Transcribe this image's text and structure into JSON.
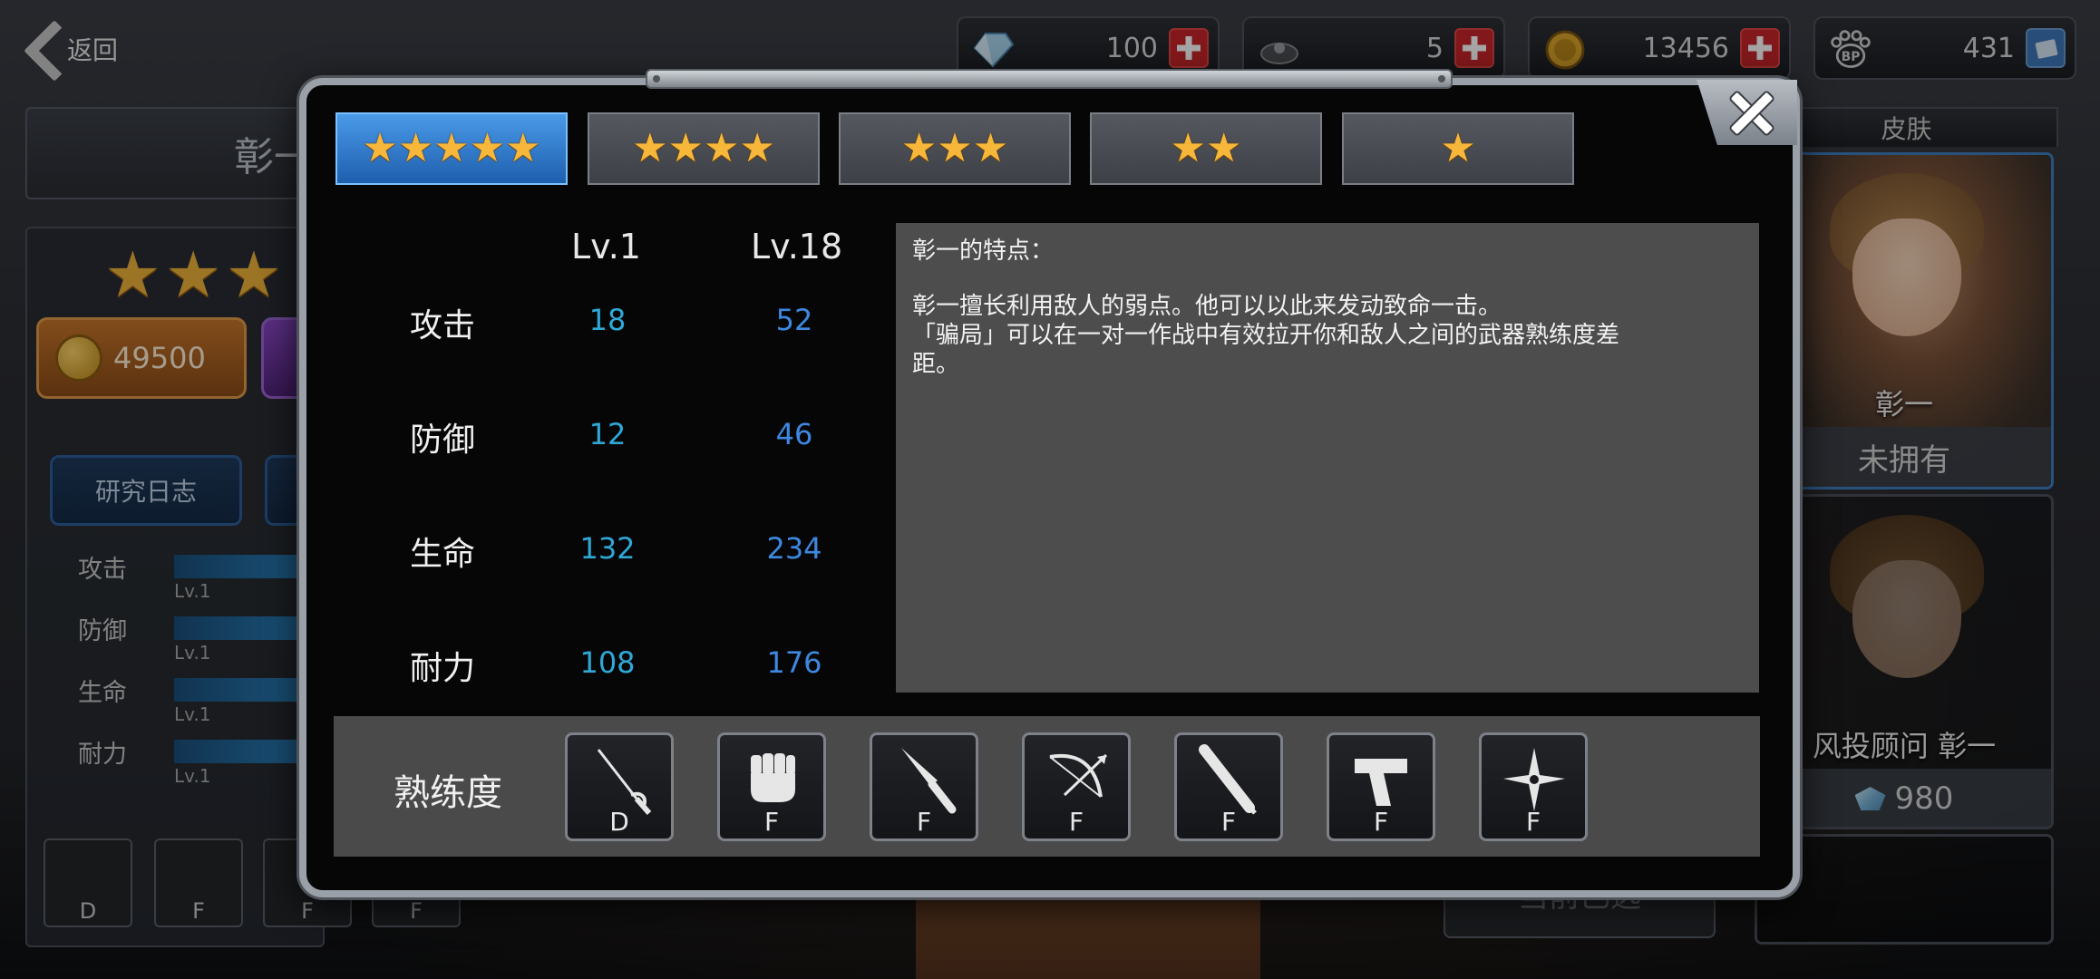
{
  "top_bar": {
    "back_label": "返回",
    "currencies": [
      {
        "icon": "diamond-icon",
        "value": "100"
      },
      {
        "icon": "ticket-icon",
        "value": "5"
      },
      {
        "icon": "gold-coin-icon",
        "value": "13456"
      },
      {
        "icon": "bp-paw-icon",
        "value": "431"
      }
    ]
  },
  "background_left": {
    "character_name_partial": "彰一",
    "gold_cost": "49500",
    "research_tab": "研究日志",
    "stats": [
      {
        "label": "攻击",
        "lv": "Lv.1"
      },
      {
        "label": "防御",
        "lv": "Lv.1"
      },
      {
        "label": "生命",
        "lv": "Lv.1"
      },
      {
        "label": "耐力",
        "lv": "Lv.1"
      }
    ],
    "weapon_grades": [
      "D",
      "F",
      "F",
      "F"
    ]
  },
  "background_right": {
    "header": "皮肤",
    "skins": [
      {
        "name": "彰一",
        "status": "未拥有"
      },
      {
        "name": "风投顾问 彰一",
        "price": "980"
      }
    ],
    "select_button": "当前已选"
  },
  "modal": {
    "rank_tabs": [
      {
        "stars": "★★★★★",
        "selected": true
      },
      {
        "stars": "★★★★",
        "selected": false
      },
      {
        "stars": "★★★",
        "selected": false
      },
      {
        "stars": "★★",
        "selected": false
      },
      {
        "stars": "★",
        "selected": false
      }
    ],
    "columns": {
      "lv_min": "Lv.1",
      "lv_max": "Lv.18"
    },
    "stats": [
      {
        "name": "攻击",
        "min": "18",
        "max": "52"
      },
      {
        "name": "防御",
        "min": "12",
        "max": "46"
      },
      {
        "name": "生命",
        "min": "132",
        "max": "234"
      },
      {
        "name": "耐力",
        "min": "108",
        "max": "176"
      }
    ],
    "description": {
      "title": "彰一的特点：",
      "body": "彰一擅长利用敌人的弱点。他可以以此来发动致命一击。\n「骗局」可以在一对一作战中有效拉开你和敌人之间的武器熟练度差\n距。"
    },
    "proficiency": {
      "label": "熟练度",
      "weapons": [
        {
          "icon": "rapier-icon",
          "grade": "D"
        },
        {
          "icon": "fist-icon",
          "grade": "F"
        },
        {
          "icon": "knife-icon",
          "grade": "F"
        },
        {
          "icon": "bow-icon",
          "grade": "F"
        },
        {
          "icon": "bat-icon",
          "grade": "F"
        },
        {
          "icon": "pistol-icon",
          "grade": "F"
        },
        {
          "icon": "shuriken-icon",
          "grade": "F"
        }
      ]
    }
  },
  "colors": {
    "accent_blue": "#3d88e0",
    "stat_cyan": "#2fa8d6",
    "star_gold": "#f6b73a",
    "plus_red": "#c8262a"
  }
}
